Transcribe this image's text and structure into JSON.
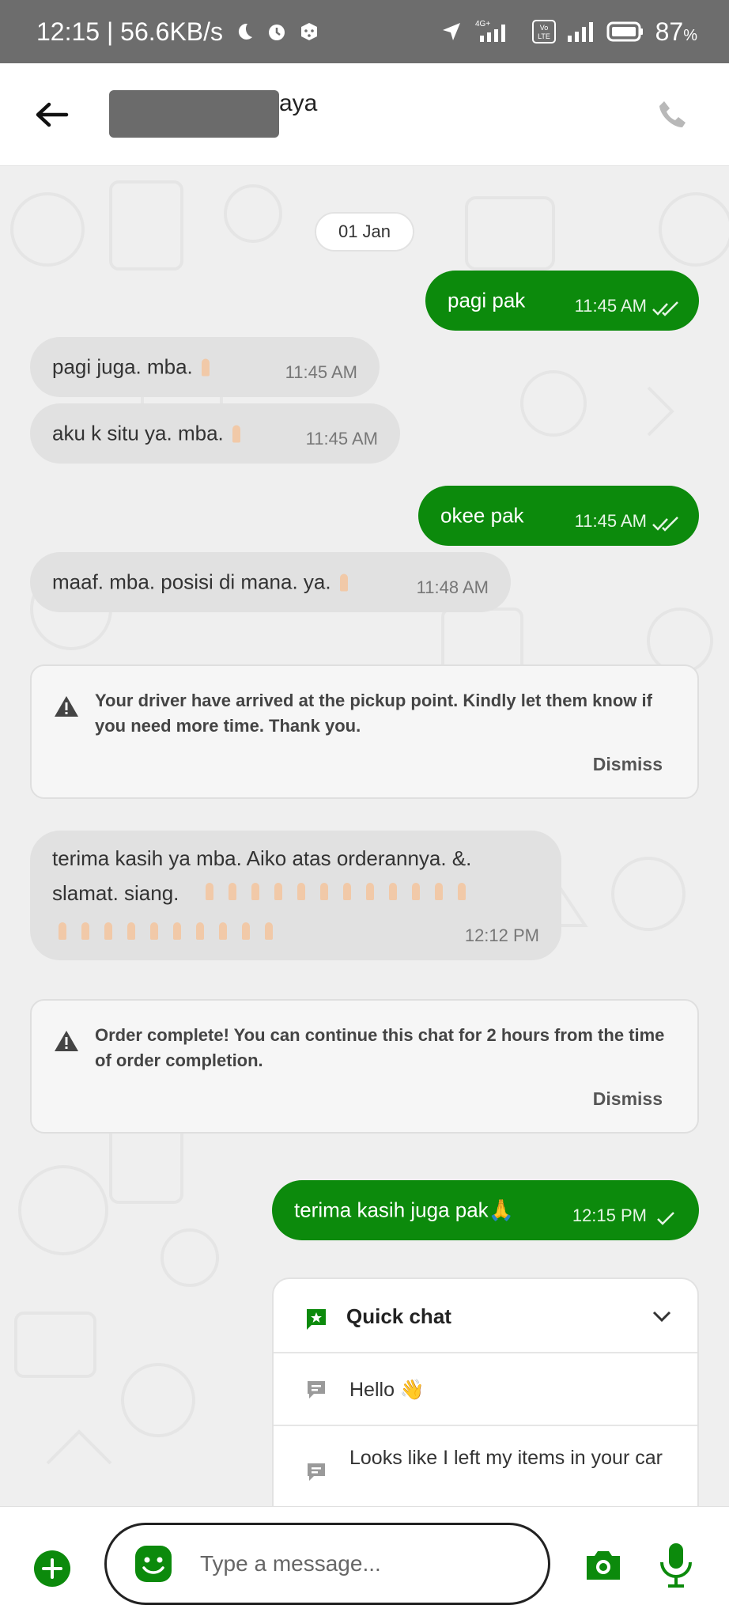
{
  "status_bar": {
    "time_speed": "12:15 | 56.6KB/s",
    "network_label": "4G+",
    "volte_label": "Vo LTE",
    "battery": "87",
    "battery_unit": "%"
  },
  "header": {
    "contact_name_visible": "aya"
  },
  "date_chip": "01 Jan",
  "messages": [
    {
      "text": "pagi pak",
      "time": "11:45 AM",
      "direction": "out",
      "status": "read"
    },
    {
      "text": "pagi juga.   mba.",
      "time": "11:45 AM",
      "direction": "in"
    },
    {
      "text": "aku k situ ya. mba.",
      "time": "11:45 AM",
      "direction": "in"
    },
    {
      "text": "okee pak",
      "time": "11:45 AM",
      "direction": "out",
      "status": "read"
    },
    {
      "text": "maaf. mba. posisi di mana. ya.",
      "time": "11:48 AM",
      "direction": "in"
    }
  ],
  "notice_arrived": {
    "text": "Your driver have arrived at the pickup point. Kindly let them know if you need more time. Thank you.",
    "dismiss": "Dismiss"
  },
  "long_message": {
    "line1": "terima kasih ya mba. Aiko atas orderannya. &.",
    "line2": "slamat. siang.",
    "time": "12:12 PM"
  },
  "notice_complete": {
    "text": "Order complete! You can continue this chat for 2 hours from the time of order completion.",
    "dismiss": "Dismiss"
  },
  "last_message": {
    "text": "terima kasih juga pak🙏",
    "time": "12:15 PM",
    "status": "sent"
  },
  "quick_chat": {
    "title": "Quick chat",
    "items": [
      {
        "text": "Hello 👋"
      },
      {
        "text": "Looks like I left my items in your car"
      }
    ]
  },
  "composer": {
    "placeholder": "Type a message..."
  },
  "colors": {
    "brand_green": "#0c8a0c",
    "incoming_bubble": "#e1e1e1",
    "chat_background": "#efefef"
  }
}
